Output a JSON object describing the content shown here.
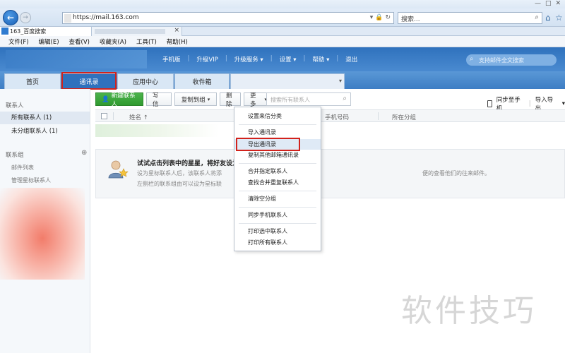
{
  "browser": {
    "url": "https://mail.163.com",
    "search_placeholder": "搜索...",
    "tab_title": "163_百度搜索",
    "win_buttons": [
      "—",
      "□",
      "✕"
    ],
    "menu": [
      "文件(F)",
      "编辑(E)",
      "查看(V)",
      "收藏夹(A)",
      "工具(T)",
      "帮助(H)"
    ]
  },
  "mail_header": {
    "links": [
      "手机版",
      "升级VIP",
      "升级服务 ▾",
      "设置 ▾",
      "帮助 ▾",
      "退出"
    ],
    "search_placeholder": "支持邮件全文搜索"
  },
  "nav_tabs": {
    "home": "首页",
    "contacts": "通讯录",
    "apps": "应用中心",
    "inbox": "收件箱"
  },
  "sidebar": {
    "section_contacts": "联系人",
    "all_contacts": "所有联系人 (1)",
    "ungrouped": "未分组联系人 (1)",
    "section_groups": "联系组",
    "mail_list": "邮件列表",
    "manage_starred": "管理星标联系人"
  },
  "toolbar": {
    "new_contact": "新建联系人",
    "write": "写 信",
    "copy_to_group": "复制到组",
    "delete": "删 除",
    "more": "更 多",
    "search_placeholder": "搜索所有联系人",
    "sync_phone": "同步至手机",
    "import_export": "导入导出"
  },
  "table": {
    "col_name": "姓名 ↑",
    "col_phone": "手机号码",
    "col_group": "所在分组"
  },
  "hint": {
    "title": "试试点击列表中的星星，将好友设为星标联系人",
    "line1": "设为星标联系人后，该联系人将添",
    "line1b": "便的查看他们的往来邮件。",
    "line2": "左侧栏的联系组由可以设为星标联"
  },
  "more_menu": {
    "items": [
      "设置来信分类",
      "导入通讯录",
      "导出通讯录",
      "复制其他邮箱通讯录",
      "合并指定联系人",
      "查找合并重复联系人",
      "清除空分组",
      "同步手机联系人",
      "打印选中联系人",
      "打印所有联系人"
    ]
  },
  "watermark": "软件技巧"
}
